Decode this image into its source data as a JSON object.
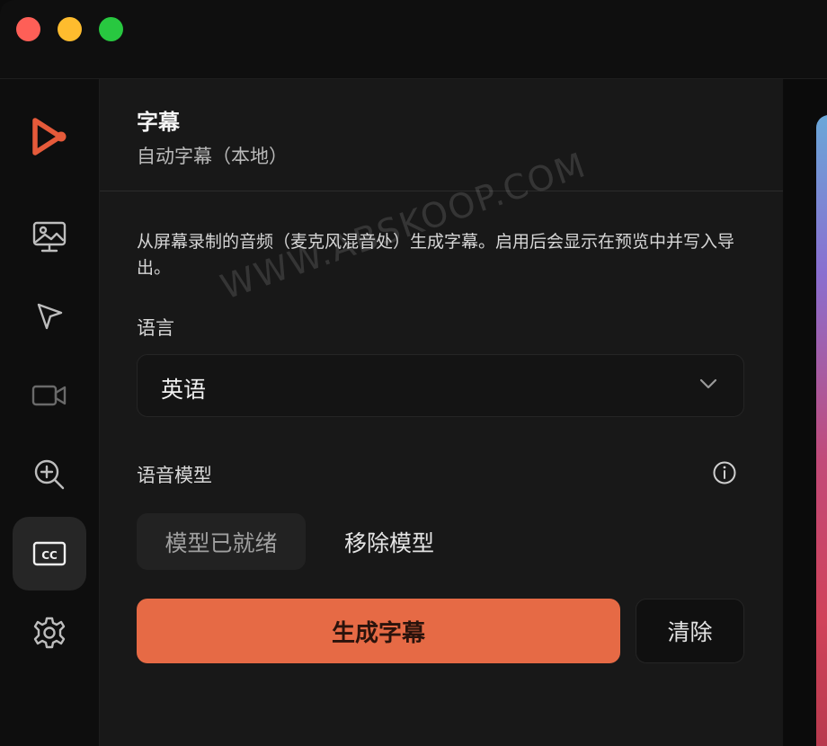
{
  "window": {
    "controls": [
      "close",
      "minimize",
      "zoom"
    ]
  },
  "sidebar": {
    "items": [
      {
        "name": "app-logo",
        "icon": "play-logo-icon",
        "active": false
      },
      {
        "name": "screen-image",
        "icon": "monitor-image-icon",
        "active": false
      },
      {
        "name": "cursor",
        "icon": "cursor-arrow-icon",
        "active": false
      },
      {
        "name": "camera",
        "icon": "video-camera-icon",
        "active": false
      },
      {
        "name": "zoom",
        "icon": "zoom-in-icon",
        "active": false
      },
      {
        "name": "captions",
        "icon": "cc-icon",
        "active": true
      },
      {
        "name": "settings",
        "icon": "gear-icon",
        "active": false
      }
    ]
  },
  "panel": {
    "title": "字幕",
    "subtitle": "自动字幕（本地）",
    "description": "从屏幕录制的音频（麦克风混音处）生成字幕。启用后会显示在预览中并写入导出。",
    "language_label": "语言",
    "language_value": "英语",
    "model_label": "语音模型",
    "model_ready_label": "模型已就绪",
    "remove_model_label": "移除模型",
    "generate_label": "生成字幕",
    "clear_label": "清除"
  },
  "watermark": "WWW.ABSKOOP.COM",
  "colors": {
    "accent": "#e66a45",
    "logo": "#e55a3a",
    "panel_bg": "#181818",
    "sidebar_bg": "#0e0e0e"
  }
}
